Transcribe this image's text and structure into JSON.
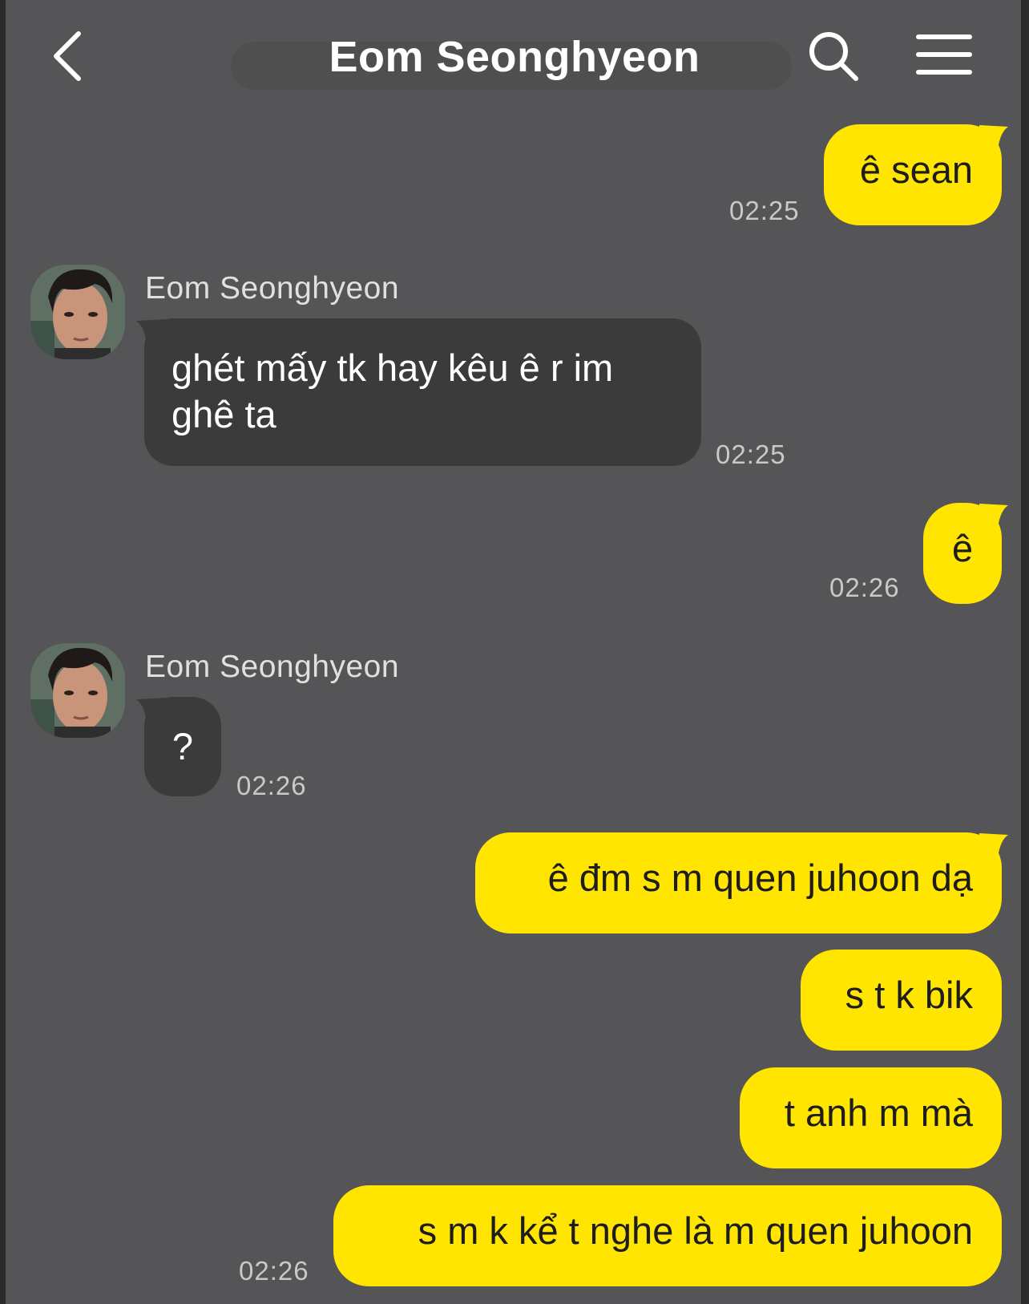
{
  "header": {
    "title": "Eom Seonghyeon"
  },
  "messages": [
    {
      "from": "me",
      "text": "ê sean",
      "time": "02:25"
    },
    {
      "from": "them",
      "sender": "Eom Seonghyeon",
      "line1": "ghét mấy tk hay kêu ê r im",
      "line2": "ghê ta",
      "time": "02:25"
    },
    {
      "from": "me",
      "text": "ê",
      "time": "02:26"
    },
    {
      "from": "them",
      "sender": "Eom Seonghyeon",
      "text": "?",
      "time": "02:26"
    },
    {
      "from": "me",
      "text": "ê đm s m quen juhoon dạ"
    },
    {
      "from": "me",
      "text": "s t k bik"
    },
    {
      "from": "me",
      "text": "t anh m mà"
    },
    {
      "from": "me",
      "text": "s m k kể t nghe là m quen juhoon",
      "time": "02:26"
    }
  ],
  "colors": {
    "background": "#555456",
    "my_bubble": "#ffe500",
    "their_bubble": "#3b3b3c"
  }
}
